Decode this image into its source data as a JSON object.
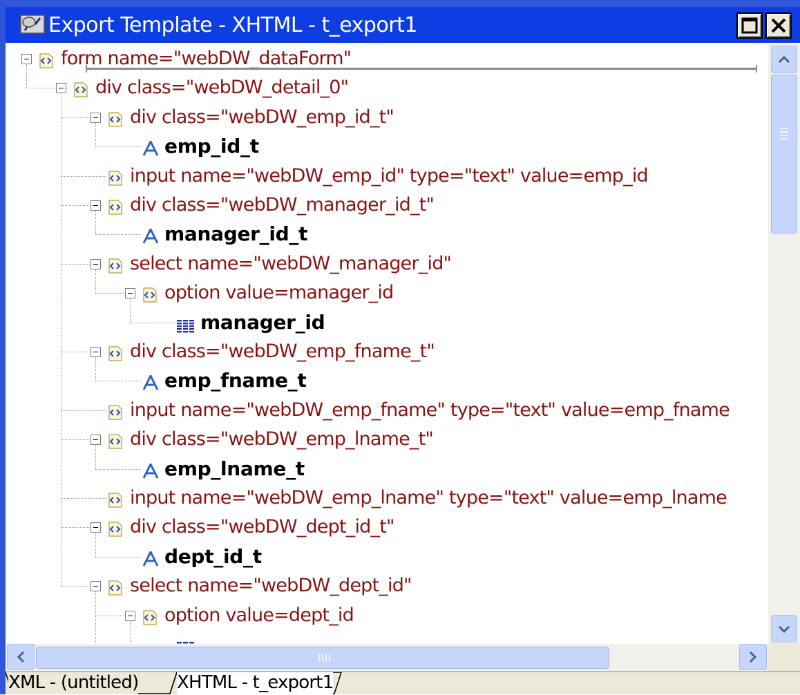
{
  "window": {
    "title": "Export Template - XHTML - t_export1",
    "restore_glyph": "□",
    "close_glyph": "✕"
  },
  "colors": {
    "titlebar": "#0e3ee3",
    "element_text": "#8a1412",
    "static_text_icon": "#2f63c4",
    "column_icon": "#1c2fb0"
  },
  "tree": {
    "nodes": [
      {
        "kind": "element",
        "label": "form name=\"webDW_dataForm\"",
        "depth": 0,
        "expander": true
      },
      {
        "kind": "element",
        "label": "div class=\"webDW_detail_0\"",
        "depth": 1,
        "expander": true
      },
      {
        "kind": "element",
        "label": "div class=\"webDW_emp_id_t\"",
        "depth": 2,
        "expander": true
      },
      {
        "kind": "static-text",
        "label": "emp_id_t",
        "depth": 3,
        "expander": false
      },
      {
        "kind": "element",
        "label": "input name=\"webDW_emp_id\" type=\"text\" value=emp_id",
        "depth": 2,
        "expander": false
      },
      {
        "kind": "element",
        "label": "div class=\"webDW_manager_id_t\"",
        "depth": 2,
        "expander": true
      },
      {
        "kind": "static-text",
        "label": "manager_id_t",
        "depth": 3,
        "expander": false
      },
      {
        "kind": "element",
        "label": "select name=\"webDW_manager_id\"",
        "depth": 2,
        "expander": true
      },
      {
        "kind": "element",
        "label": "option value=manager_id",
        "depth": 3,
        "expander": true
      },
      {
        "kind": "column",
        "label": "manager_id",
        "depth": 4,
        "expander": false
      },
      {
        "kind": "element",
        "label": "div class=\"webDW_emp_fname_t\"",
        "depth": 2,
        "expander": true
      },
      {
        "kind": "static-text",
        "label": "emp_fname_t",
        "depth": 3,
        "expander": false
      },
      {
        "kind": "element",
        "label": "input name=\"webDW_emp_fname\" type=\"text\" value=emp_fname",
        "depth": 2,
        "expander": false
      },
      {
        "kind": "element",
        "label": "div class=\"webDW_emp_lname_t\"",
        "depth": 2,
        "expander": true
      },
      {
        "kind": "static-text",
        "label": "emp_lname_t",
        "depth": 3,
        "expander": false
      },
      {
        "kind": "element",
        "label": "input name=\"webDW_emp_lname\" type=\"text\" value=emp_lname",
        "depth": 2,
        "expander": false
      },
      {
        "kind": "element",
        "label": "div class=\"webDW_dept_id_t\"",
        "depth": 2,
        "expander": true
      },
      {
        "kind": "static-text",
        "label": "dept_id_t",
        "depth": 3,
        "expander": false
      },
      {
        "kind": "element",
        "label": "select name=\"webDW_dept_id\"",
        "depth": 2,
        "expander": true
      },
      {
        "kind": "element",
        "label": "option value=dept_id",
        "depth": 3,
        "expander": true
      },
      {
        "kind": "column",
        "label": "",
        "depth": 4,
        "expander": false
      }
    ]
  },
  "scrollbars": {
    "up_icon": "scroll-up-arrow",
    "down_icon": "scroll-down-arrow",
    "left_icon": "scroll-left-arrow",
    "right_icon": "scroll-right-arrow"
  },
  "tabs": [
    {
      "label": "XML - (untitled)",
      "active": false
    },
    {
      "label": "XHTML - t_export1",
      "active": true
    }
  ]
}
